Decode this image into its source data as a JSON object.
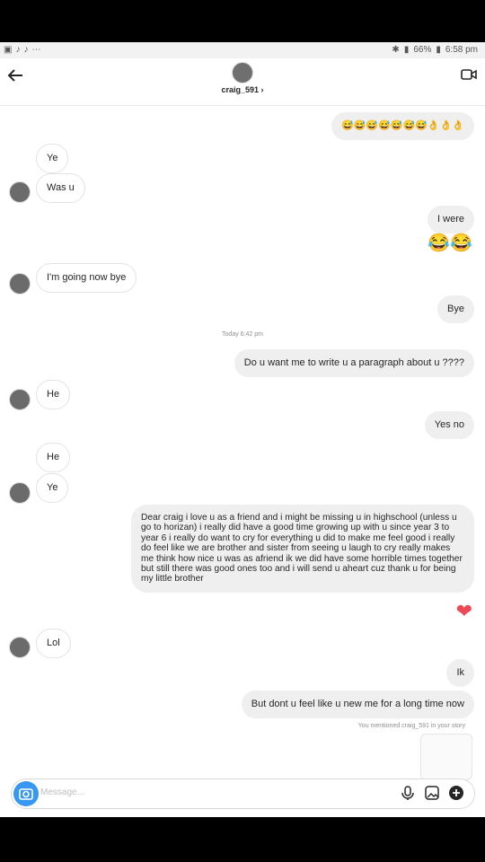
{
  "status_bar": {
    "battery": "66%",
    "time": "6:58 pm"
  },
  "header": {
    "username": "craig_591 ›"
  },
  "messages": {
    "m1": "😅😅😅😅😅😅😅👌👌👌",
    "m2": "Ye",
    "m3": "Was u",
    "m4": "I were",
    "m5": "😂😂",
    "m6": "I'm going now bye",
    "m7": "Bye",
    "ts": "Today 6:42 pm",
    "m8": "Do u want me to write u a paragraph about u ????",
    "m9": "He",
    "m10": "Yes no",
    "m11": "He",
    "m12": "Ye",
    "m13": "Dear craig i love u as a friend and i might be missing u in highschool (unless u go to horizan) i really did have a good time growing up with u since year 3 to year 6 i really do want to cry for everything u did to make me feel good i really do feel like we are brother and sister from seeing u laugh to cry really makes me think how nice u was as afriend ik we did have some horrible times together but still there was good ones too and i will send u aheart cuz thank u for being my little brother",
    "m14": "❤",
    "m15": "Lol",
    "m16": "Ik",
    "m17": "But dont u feel like u new me for a long time now",
    "mention": "You mentioned craig_591 in your story"
  },
  "composer": {
    "placeholder": "Message..."
  },
  "colors": {
    "accent": "#3897f0",
    "heart": "#ed4956"
  }
}
